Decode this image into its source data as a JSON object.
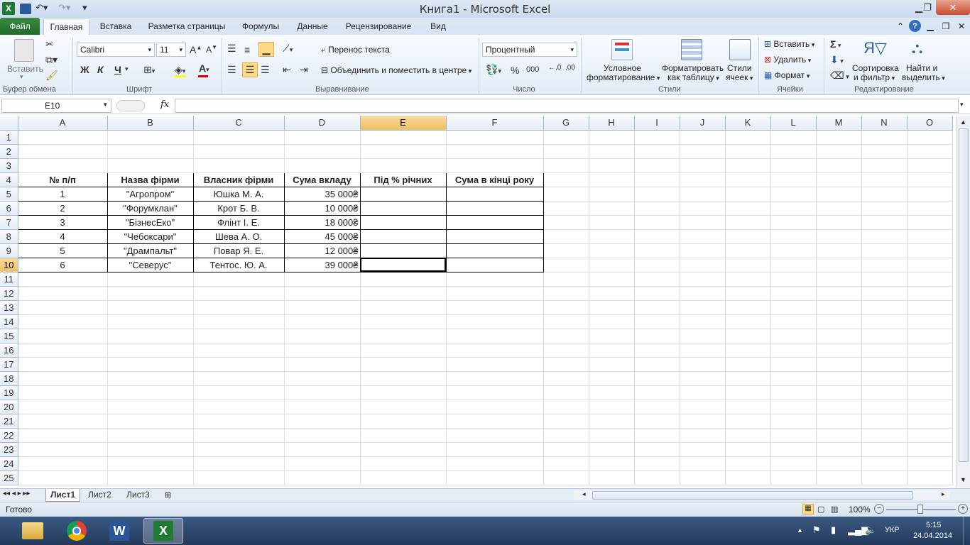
{
  "window": {
    "title": "Книга1  -  Microsoft Excel"
  },
  "tabs": [
    "Файл",
    "Главная",
    "Вставка",
    "Разметка страницы",
    "Формулы",
    "Данные",
    "Рецензирование",
    "Вид"
  ],
  "clipboard": {
    "paste": "Вставить",
    "group": "Буфер обмена"
  },
  "font": {
    "name": "Calibri",
    "size": "11",
    "bold": "Ж",
    "italic": "К",
    "underline": "Ч",
    "group": "Шрифт"
  },
  "alignment": {
    "wrap": "Перенос текста",
    "merge": "Объединить и поместить в центре",
    "group": "Выравнивание"
  },
  "number": {
    "format": "Процентный",
    "percent": "%",
    "thousands": "000",
    "group": "Число"
  },
  "styles": {
    "conditional": "Условное",
    "conditional2": "форматирование",
    "astable": "Форматировать",
    "astable2": "как таблицу",
    "cellstyles": "Стили",
    "cellstyles2": "ячеек",
    "group": "Стили"
  },
  "cells": {
    "insert": "Вставить",
    "delete": "Удалить",
    "format": "Формат",
    "group": "Ячейки"
  },
  "editing": {
    "sort": "Сортировка",
    "sort2": "и фильтр",
    "find": "Найти и",
    "find2": "выделить",
    "group": "Редактирование"
  },
  "formula_bar": {
    "namebox": "E10",
    "fx": "fx",
    "formula": ""
  },
  "columns": [
    "A",
    "B",
    "C",
    "D",
    "E",
    "F",
    "G",
    "H",
    "I",
    "J",
    "K",
    "L",
    "M",
    "N",
    "O"
  ],
  "rows": [
    "1",
    "2",
    "3",
    "4",
    "5",
    "6",
    "7",
    "8",
    "9",
    "10",
    "11",
    "12",
    "13",
    "14",
    "15",
    "16",
    "17",
    "18",
    "19",
    "20",
    "21",
    "22",
    "23",
    "24",
    "25"
  ],
  "table": {
    "headers": [
      "№ п/п",
      "Назва фірми",
      "Власник фірми",
      "Сума вкладу",
      "Під % річних",
      "Сума в кінці року"
    ],
    "data": [
      [
        "1",
        "\"Агропром\"",
        "Юшка М. А.",
        "35 000₴",
        "",
        ""
      ],
      [
        "2",
        "\"Форумклан\"",
        "Крот Б. В.",
        "10 000₴",
        "",
        ""
      ],
      [
        "3",
        "\"БізнесЕко\"",
        "Флінт І. Е.",
        "18 000₴",
        "",
        ""
      ],
      [
        "4",
        "\"Чебоксари\"",
        "Шева А. О.",
        "45 000₴",
        "",
        ""
      ],
      [
        "5",
        "\"Дрампальт\"",
        "Повар Я. Е.",
        "12 000₴",
        "",
        ""
      ],
      [
        "6",
        "\"Северус\"",
        "Тентос. Ю. А.",
        "39 000₴",
        "",
        ""
      ]
    ]
  },
  "sheets": [
    "Лист1",
    "Лист2",
    "Лист3"
  ],
  "status": {
    "ready": "Готово",
    "zoom": "100%"
  },
  "tray": {
    "lang": "УКР",
    "time": "5:15",
    "date": "24.04.2014"
  }
}
